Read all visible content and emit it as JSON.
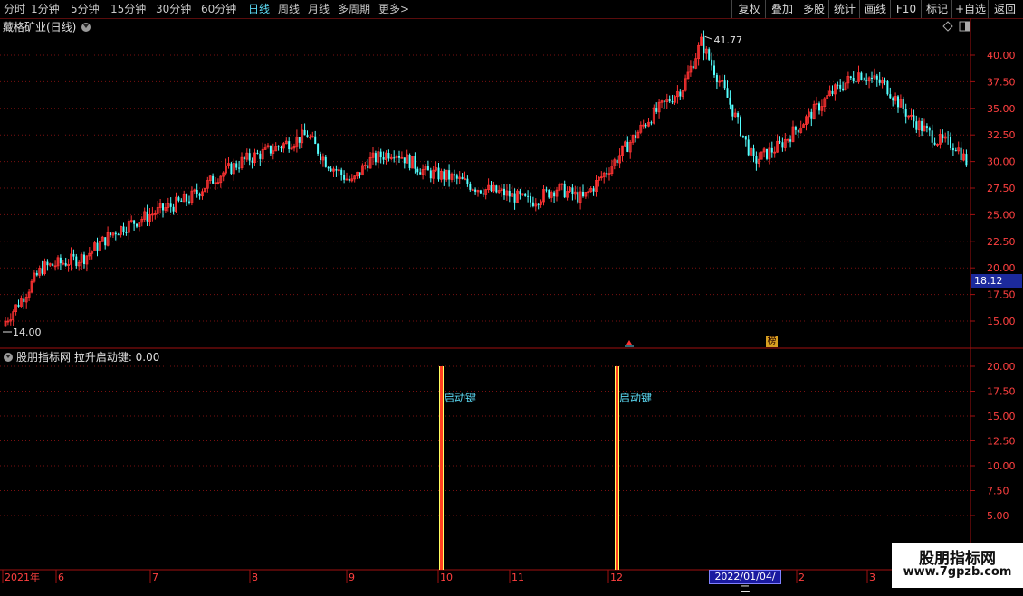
{
  "toolbar": {
    "periods": [
      "分时",
      "1分钟",
      "5分钟",
      "15分钟",
      "30分钟",
      "60分钟",
      "日线",
      "周线",
      "月线",
      "多周期",
      "更多"
    ],
    "active_period": "日线",
    "more_arrow": ">",
    "right_buttons": [
      "复权",
      "叠加",
      "多股",
      "统计",
      "画线",
      "F10",
      "标记",
      "+自选",
      "返回"
    ]
  },
  "main_chart": {
    "title": "藏格矿业(日线)",
    "max_label": "41.77",
    "min_label": "14.00",
    "current_price": "18.12",
    "y_ticks": [
      "40.00",
      "37.50",
      "35.00",
      "32.50",
      "30.00",
      "27.50",
      "25.00",
      "22.50",
      "20.00",
      "17.50",
      "15.00"
    ],
    "badge": "榜"
  },
  "indicator": {
    "title": "股朋指标网 拉升启动键: 0.00",
    "signal_label": "启动键",
    "y_ticks": [
      "20.00",
      "17.50",
      "15.00",
      "12.50",
      "10.00",
      "7.50",
      "5.00"
    ]
  },
  "x_axis": {
    "labels": [
      "2021年",
      "6",
      "7",
      "8",
      "9",
      "10",
      "11",
      "12",
      "1",
      "2",
      "3"
    ],
    "cursor_date": "2022/01/04/二"
  },
  "watermark": {
    "line1": "股朋指标网",
    "line2": "www.7gpzb.com"
  },
  "colors": {
    "up": "#ff3232",
    "down": "#54ffff",
    "grid": "#7a1010",
    "axis": "#a01010",
    "signal": "#ffcc00"
  }
}
